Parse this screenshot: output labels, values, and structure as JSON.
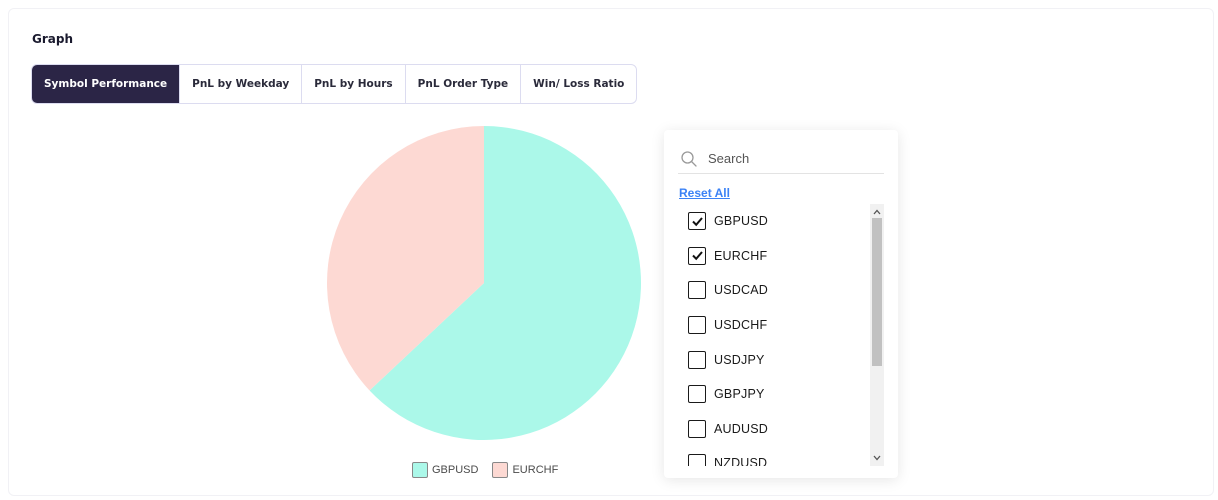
{
  "section": {
    "title": "Graph"
  },
  "tabs": [
    {
      "label": "Symbol Performance",
      "active": true
    },
    {
      "label": "PnL by Weekday",
      "active": false
    },
    {
      "label": "PnL by Hours",
      "active": false
    },
    {
      "label": "PnL Order Type",
      "active": false
    },
    {
      "label": "Win/ Loss Ratio",
      "active": false
    }
  ],
  "chart_data": {
    "type": "pie",
    "slices": [
      {
        "label": "GBPUSD",
        "value": 63,
        "color": "#abf8e9"
      },
      {
        "label": "EURCHF",
        "value": 37,
        "color": "#fdd9d3"
      }
    ],
    "legend": [
      "GBPUSD",
      "EURCHF"
    ],
    "legend_position": "bottom"
  },
  "dropdown": {
    "search_placeholder": "Search",
    "reset_label": "Reset All",
    "items": [
      {
        "label": "GBPUSD",
        "checked": true
      },
      {
        "label": "EURCHF",
        "checked": true
      },
      {
        "label": "USDCAD",
        "checked": false
      },
      {
        "label": "USDCHF",
        "checked": false
      },
      {
        "label": "USDJPY",
        "checked": false
      },
      {
        "label": "GBPJPY",
        "checked": false
      },
      {
        "label": "AUDUSD",
        "checked": false
      },
      {
        "label": "NZDUSD",
        "checked": false
      }
    ],
    "icons": {
      "search": "search-icon",
      "check": "check-icon",
      "up": "chevron-up-icon",
      "down": "chevron-down-icon"
    }
  },
  "colors": {
    "tab_active_bg": "#2b2546",
    "link": "#3b82f6"
  }
}
